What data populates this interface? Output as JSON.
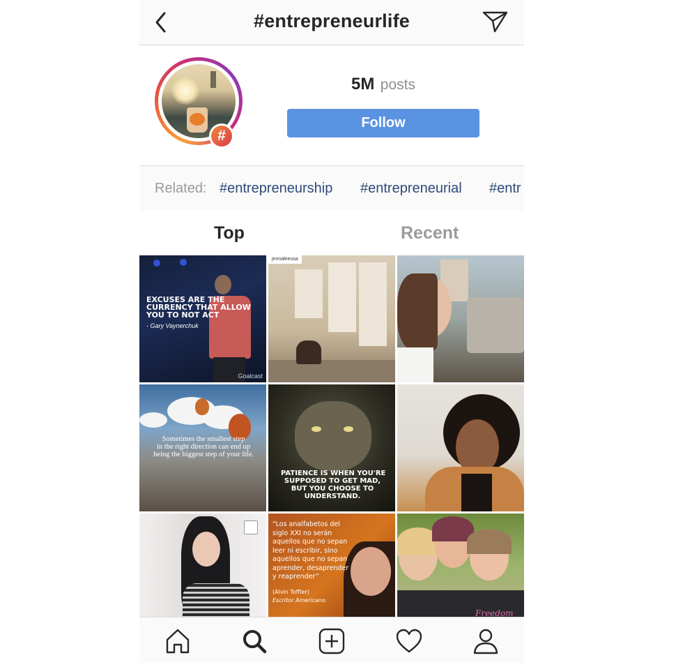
{
  "header": {
    "title": "#entrepreneurlife",
    "back_icon": "chevron-left-icon",
    "direct_icon": "paper-plane-icon"
  },
  "profile": {
    "post_count": "5M",
    "post_label": "posts",
    "follow_label": "Follow",
    "badge_symbol": "#"
  },
  "related": {
    "label": "Related:",
    "tags": [
      "#entrepreneurship",
      "#entrepreneurial",
      "#entr"
    ]
  },
  "tabs": {
    "top": "Top",
    "recent": "Recent"
  },
  "grid": {
    "post1_quote": "EXCUSES ARE THE\nCURRENCY THAT ALLOW\nYOU TO NOT ACT",
    "post1_author": "- Gary Vaynerchuk",
    "post1_watermark": "Goalcast",
    "post2_repost": "jennaleeusa",
    "post4_quote": "Sometimes the smallest step\nin the right direction can end up\nbeing the biggest step of your life.",
    "post5_quote": "PATIENCE IS WHEN YOU'RE\nSUPPOSED TO GET MAD,\nBUT YOU CHOOSE TO\nUNDERSTAND.",
    "post8_quote": "“Los analfabetos del\nsiglo XXI no serán\naquellos que no sepan\nleer ni escribir, sino\naquellos que no sepan\naprender, desaprender\ny reaprender”",
    "post8_author": "(Alvin Toffler)",
    "post8_subauthor": "Escritor Americano",
    "post9_text": "Freedom"
  },
  "nav": {
    "items": [
      "home-icon",
      "search-icon",
      "add-post-icon",
      "activity-heart-icon",
      "profile-icon"
    ]
  },
  "colors": {
    "follow_button": "#5a93e2",
    "related_tag": "#2e4a78",
    "inactive_text": "#9b9b9b"
  }
}
